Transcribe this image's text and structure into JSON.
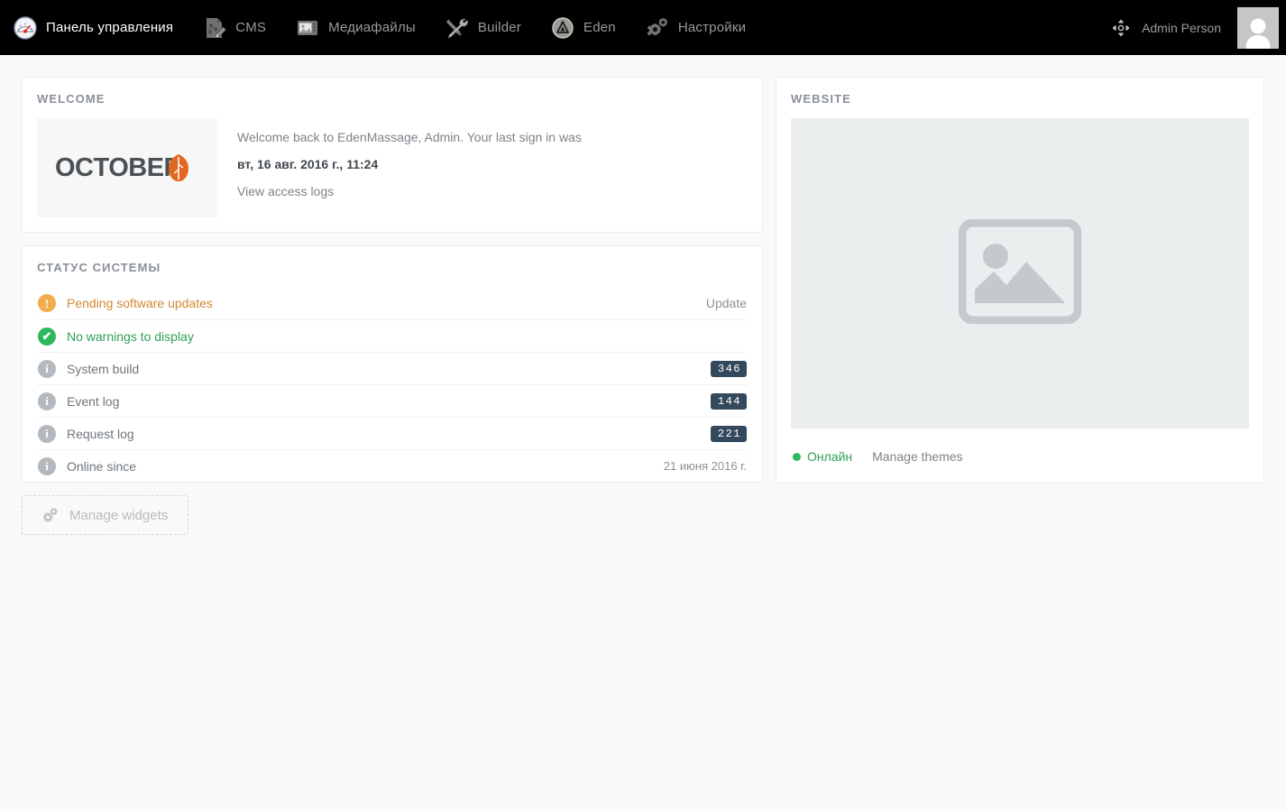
{
  "nav": {
    "items": [
      {
        "label": "Панель управления",
        "icon": "dashboard-gauge-icon",
        "active": true
      },
      {
        "label": "CMS",
        "icon": "cms-page-pencil-icon",
        "active": false
      },
      {
        "label": "Медиафайлы",
        "icon": "media-camera-icon",
        "active": false
      },
      {
        "label": "Builder",
        "icon": "builder-tools-icon",
        "active": false
      },
      {
        "label": "Eden",
        "icon": "eden-circle-triangle-icon",
        "active": false
      },
      {
        "label": "Настройки",
        "icon": "settings-gears-icon",
        "active": false
      }
    ],
    "user_label": "Admin Person",
    "move_icon": "move-arrows-icon",
    "avatar_icon": "user-avatar-icon"
  },
  "welcome": {
    "title": "WELCOME",
    "logo_text": "OCTOBER",
    "message": "Welcome back to EdenMassage, Admin. Your last sign in was",
    "last_signin": "вт, 16 авг. 2016 г., 11:24",
    "access_logs_link": "View access logs"
  },
  "system_status": {
    "title": "СТАТУС СИСТЕМЫ",
    "rows": [
      {
        "icon": "warning-icon",
        "kind": "warn",
        "label": "Pending software updates",
        "action": "Update",
        "value": "",
        "badge": ""
      },
      {
        "icon": "check-icon",
        "kind": "ok",
        "label": "No warnings to display",
        "action": "",
        "value": "",
        "badge": ""
      },
      {
        "icon": "info-icon",
        "kind": "info",
        "label": "System build",
        "action": "",
        "value": "",
        "badge": "346"
      },
      {
        "icon": "info-icon",
        "kind": "info",
        "label": "Event log",
        "action": "",
        "value": "",
        "badge": "144"
      },
      {
        "icon": "info-icon",
        "kind": "info",
        "label": "Request log",
        "action": "",
        "value": "",
        "badge": "221"
      },
      {
        "icon": "info-icon",
        "kind": "info",
        "label": "Online since",
        "action": "",
        "value": "21 июня 2016 г.",
        "badge": ""
      }
    ]
  },
  "manage_widgets": {
    "label": "Manage widgets",
    "icon": "cogs-icon"
  },
  "website": {
    "title": "WEBSITE",
    "preview_icon": "image-placeholder-icon",
    "status_label": "Онлайн",
    "manage_themes_link": "Manage themes"
  },
  "colors": {
    "nav_bg": "#000000",
    "page_bg": "#f9f9f9",
    "card_bg": "#ffffff",
    "accent_orange": "#f0ad4e",
    "accent_green": "#2eb85c",
    "badge_bg": "#34495c",
    "muted_text": "#8a9097"
  }
}
